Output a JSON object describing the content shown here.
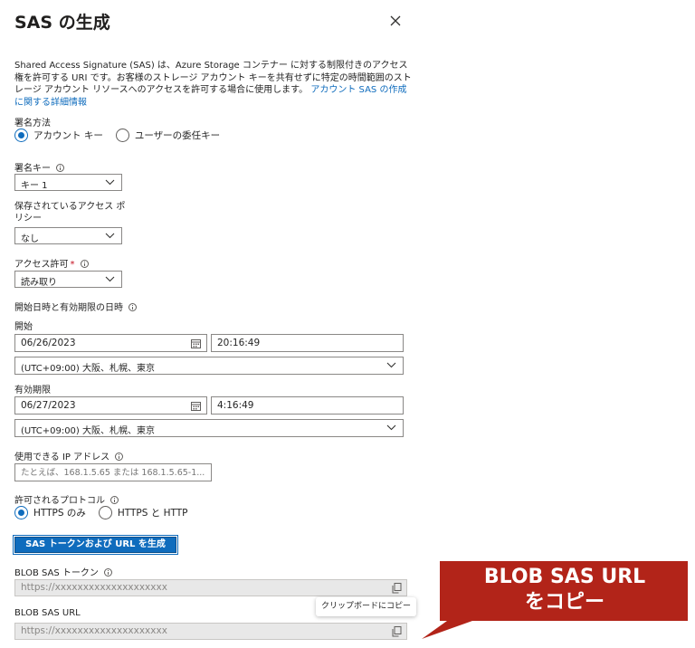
{
  "panel": {
    "title": "SAS の生成",
    "description": "Shared Access Signature (SAS) は、Azure Storage コンテナー に対する制限付きのアクセス権を許可する URI です。お客様のストレージ アカウント キーを共有せずに特定の時間範囲のストレージ アカウント リソースへのアクセスを許可する場合に使用します。",
    "description_link": "アカウント SAS の作成に関する詳細情報"
  },
  "signing_method": {
    "label": "署名方法",
    "options": [
      "アカウント キー",
      "ユーザーの委任キー"
    ],
    "selected": "アカウント キー"
  },
  "signing_key": {
    "label": "署名キー",
    "value": "キー 1"
  },
  "stored_policy": {
    "label_line1": "保存されているアクセス ポ",
    "label_line2": "リシー",
    "value": "なし"
  },
  "permissions": {
    "label": "アクセス許可",
    "required_mark": "*",
    "value": "読み取り"
  },
  "datetime_section": {
    "label": "開始日時と有効期限の日時"
  },
  "start": {
    "label": "開始",
    "date": "06/26/2023",
    "time": "20:16:49",
    "timezone": "(UTC+09:00) 大阪、札幌、東京"
  },
  "expiry": {
    "label": "有効期限",
    "date": "06/27/2023",
    "time": "4:16:49",
    "timezone": "(UTC+09:00) 大阪、札幌、東京"
  },
  "allowed_ip": {
    "label": "使用できる IP アドレス",
    "placeholder": "たとえば、168.1.5.65 または 168.1.5.65-1..."
  },
  "protocols": {
    "label": "許可されるプロトコル",
    "options": [
      "HTTPS のみ",
      "HTTPS と HTTP"
    ],
    "selected": "HTTPS のみ"
  },
  "generate_button": {
    "label": "SAS トークンおよび URL を生成"
  },
  "blob_sas_token": {
    "label": "BLOB SAS トークン",
    "value": "https://xxxxxxxxxxxxxxxxxxxx"
  },
  "blob_sas_url": {
    "label": "BLOB SAS URL",
    "value": "https://xxxxxxxxxxxxxxxxxxxx"
  },
  "tooltip": {
    "text": "クリップボードにコピー"
  },
  "callout": {
    "line1": "BLOB SAS URL",
    "line2": "をコピー",
    "color": "#b22419"
  },
  "colors": {
    "accent": "#0f6cbd",
    "required": "#c50f1f"
  },
  "icons": [
    "close-icon",
    "info-icon",
    "chevron-down-icon",
    "calendar-icon",
    "copy-icon"
  ]
}
